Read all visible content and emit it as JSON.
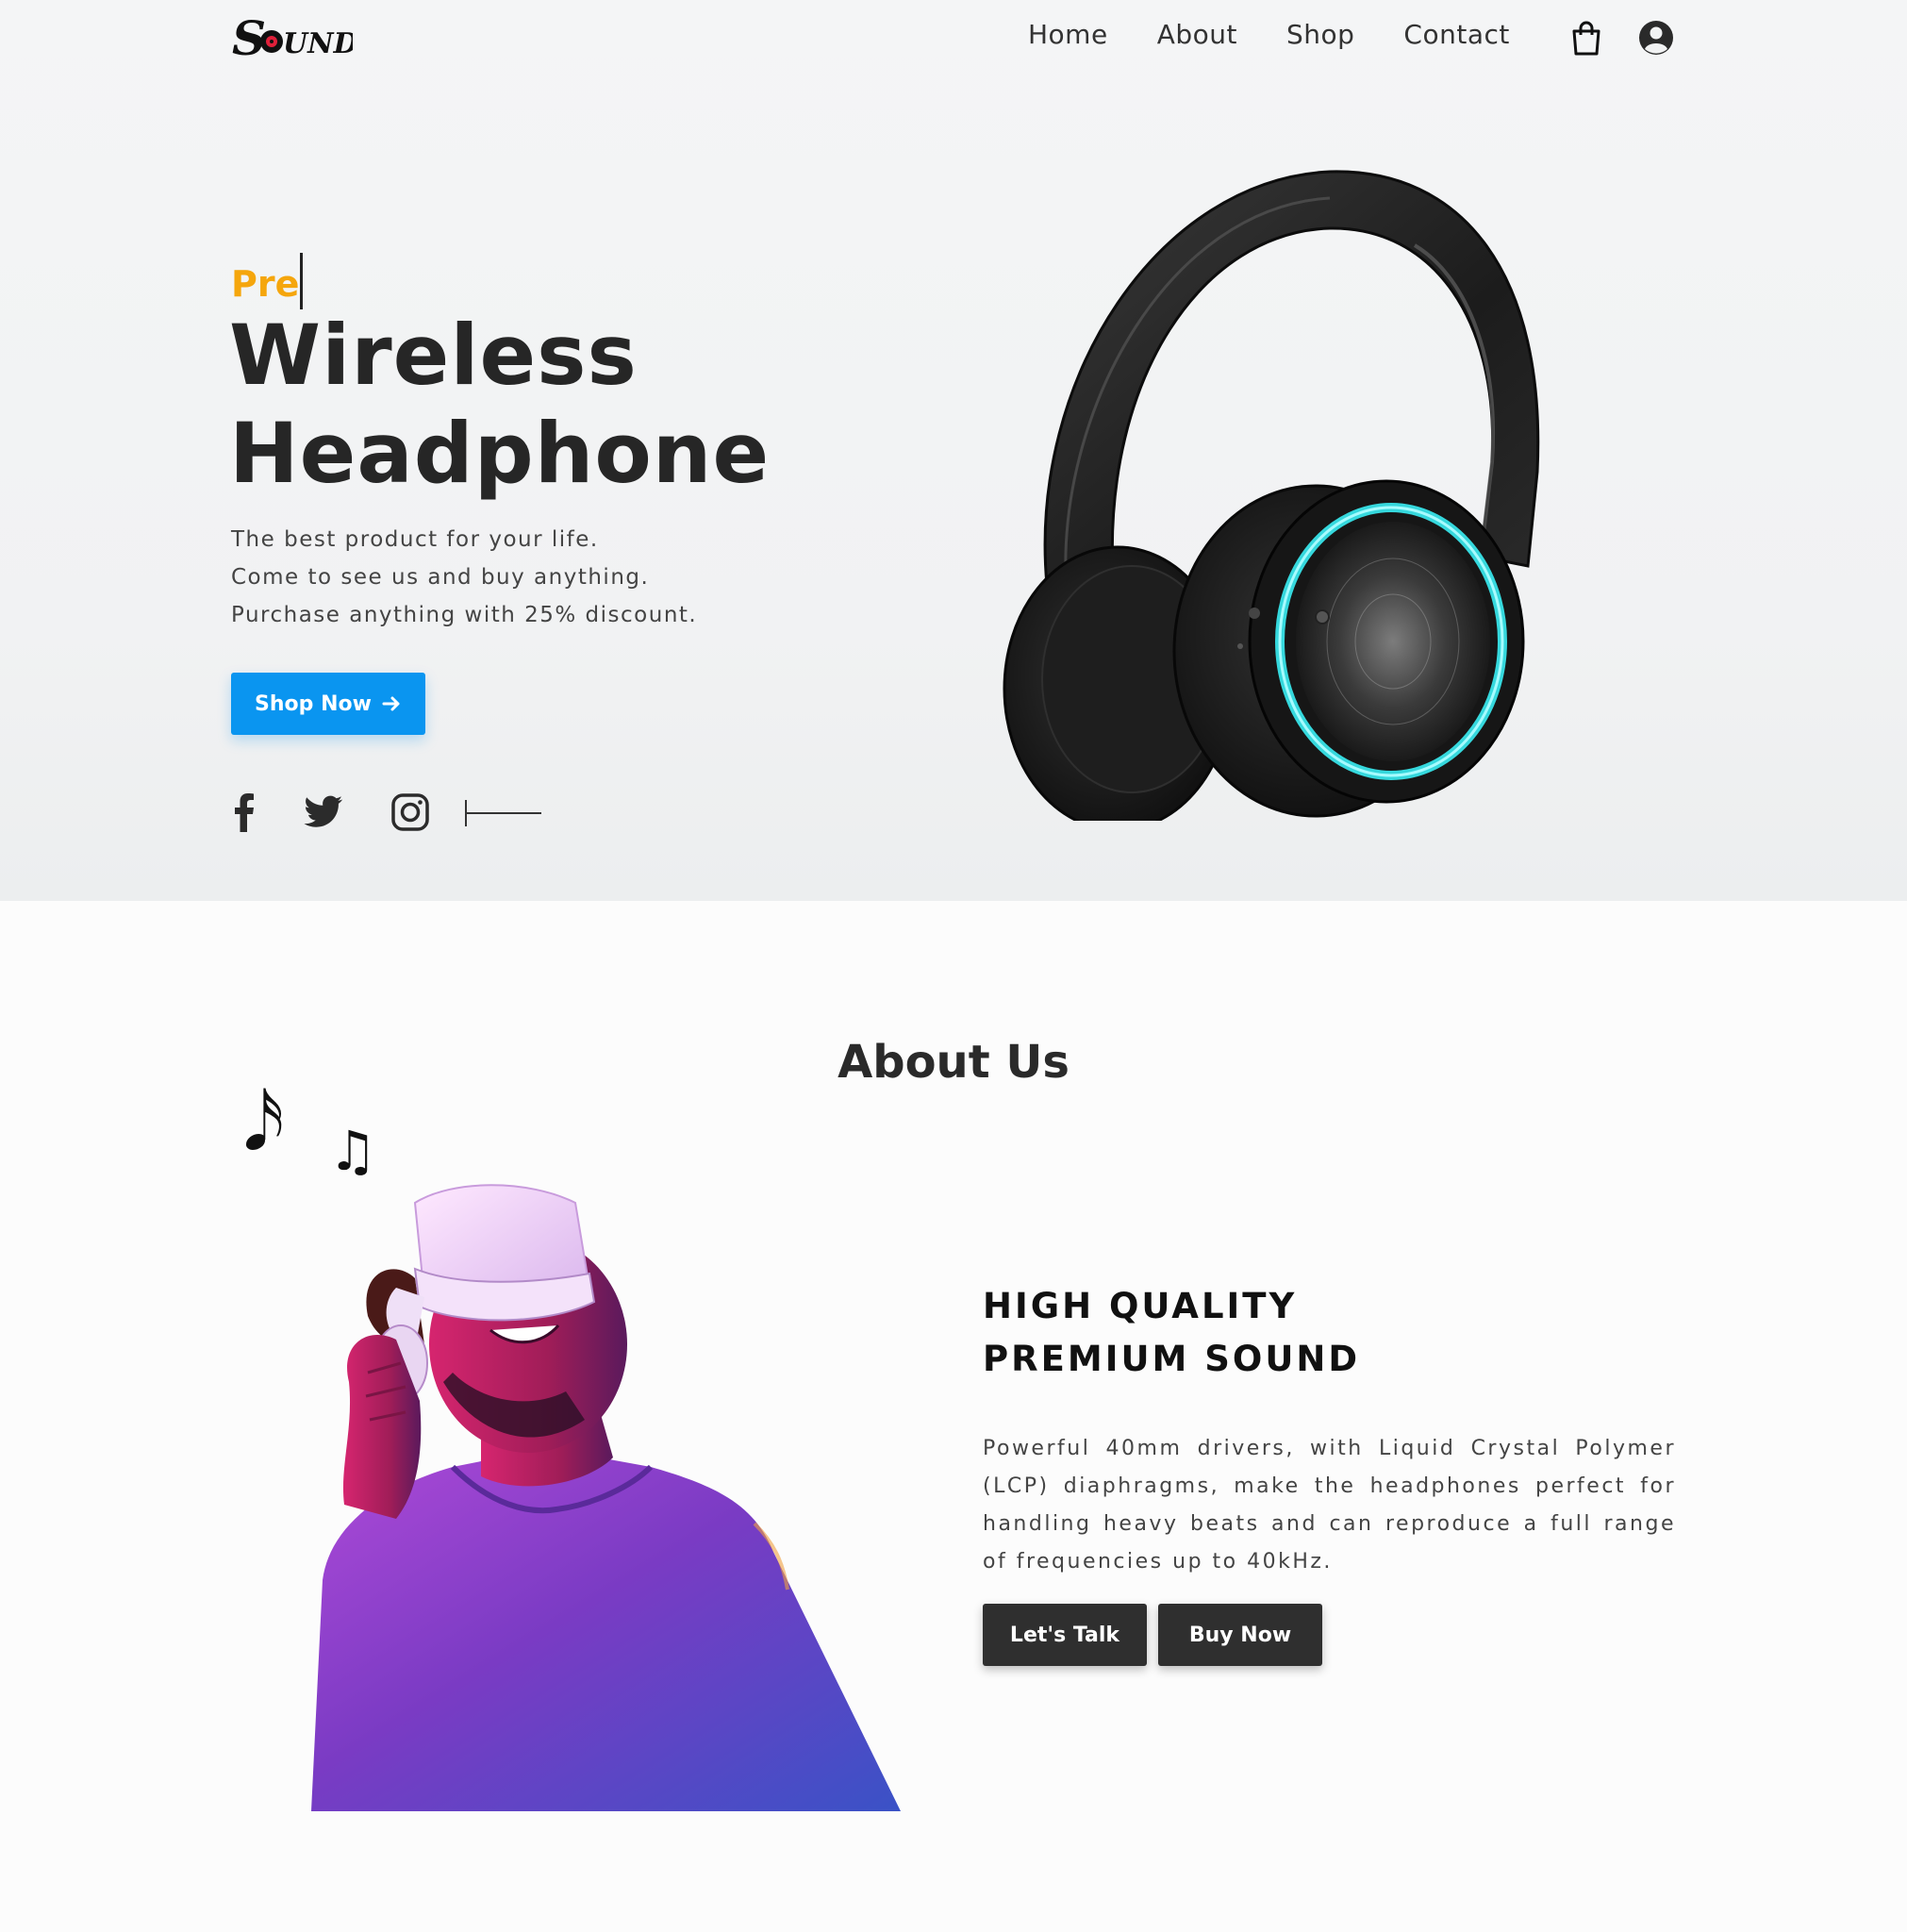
{
  "brand": {
    "logo_text": "SOUND"
  },
  "nav": {
    "links": [
      {
        "label": "Home"
      },
      {
        "label": "About"
      },
      {
        "label": "Shop"
      },
      {
        "label": "Contact"
      }
    ],
    "cart_icon": "shopping-bag-icon",
    "user_icon": "user-circle-icon"
  },
  "hero": {
    "eyebrow": "Pre",
    "title_line1": "Wireless",
    "title_line2": "Headphone",
    "description": [
      "The best product for your life.",
      "Come to see us and buy anything.",
      "Purchase anything with 25% discount."
    ],
    "cta_label": "Shop Now",
    "cta_icon": "arrow-right-icon",
    "social": [
      "facebook-icon",
      "twitter-icon",
      "instagram-icon"
    ],
    "accent_color": "#f5a60d",
    "button_color": "#0a95f0"
  },
  "about": {
    "title": "About Us",
    "heading_line1": "HIGH QUALITY",
    "heading_line2": "PREMIUM SOUND",
    "description": "Powerful 40mm drivers, with Liquid Crystal Polymer (LCP) diaphragms, make the headphones perfect for handling heavy beats and can reproduce a full range of frequencies up to 40kHz.",
    "buttons": [
      {
        "label": "Let's Talk"
      },
      {
        "label": "Buy Now"
      }
    ]
  }
}
